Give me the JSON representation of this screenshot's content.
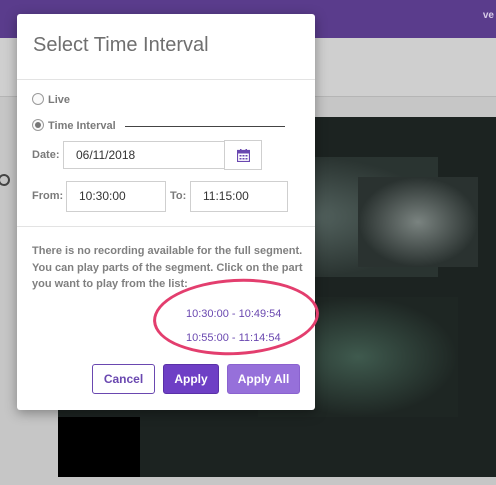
{
  "topbar": {
    "corner_text": "ve"
  },
  "dialog": {
    "title": "Select Time Interval",
    "radio_live": "Live",
    "radio_interval": "Time Interval",
    "date_label": "Date:",
    "date_value": "06/11/2018",
    "from_label": "From:",
    "from_value": "10:30:00",
    "to_label": "To:",
    "to_value": "11:15:00",
    "message": "There is no recording available for the full segment. You can play parts of the segment. Click on the part you want to play from the list:",
    "segments": [
      "10:30:00 - 10:49:54",
      "10:55:00 - 11:14:54"
    ],
    "buttons": {
      "cancel": "Cancel",
      "apply": "Apply",
      "apply_all": "Apply All"
    }
  },
  "colors": {
    "accent": "#6e3fc5",
    "highlight_ellipse": "#e33e6e",
    "topbar": "#5a3c8c"
  },
  "icons": {
    "calendar": "calendar-icon",
    "search": "search-icon"
  }
}
